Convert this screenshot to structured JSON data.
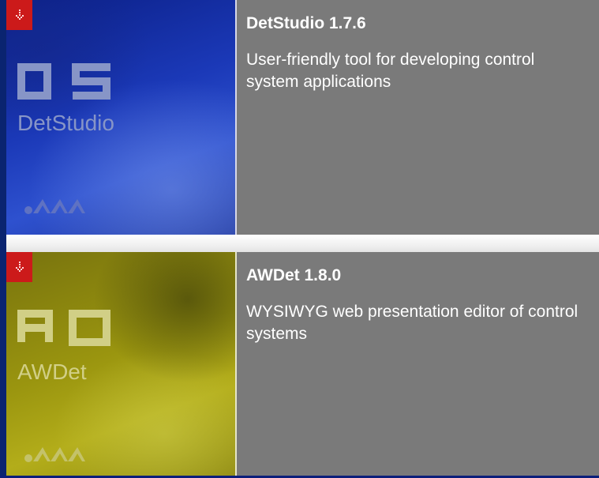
{
  "products": [
    {
      "title": "DetStudio 1.7.6",
      "description": "User-friendly tool for developing control system applications",
      "logo_letters": "DS",
      "logo_name": "DetStudio",
      "tile_theme": "blue",
      "badge_icon": "download-icon",
      "brand_icon": "brand-mark-icon"
    },
    {
      "title": "AWDet 1.8.0",
      "description": "WYSIWYG web presentation editor of control systems",
      "logo_letters": "AD",
      "logo_name": "AWDet",
      "tile_theme": "olive",
      "badge_icon": "download-icon",
      "brand_icon": "brand-mark-icon"
    }
  ],
  "colors": {
    "background": "#0b1e7a",
    "info_panel": "#7a7a7a",
    "badge": "#cc1a1a",
    "tile_blue": "#1b39b8",
    "tile_olive": "#9a950f",
    "divider": "#f0f0f0"
  }
}
